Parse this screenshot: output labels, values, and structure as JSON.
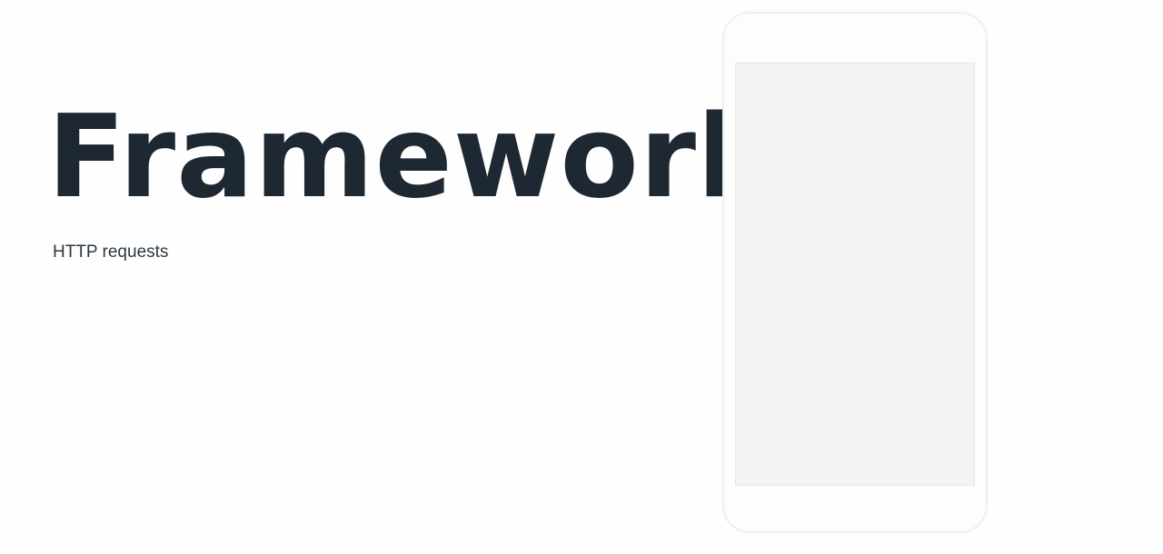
{
  "slide": {
    "title": "Framework",
    "subtitle": "HTTP requests"
  },
  "colors": {
    "background": "#fefefe",
    "title": "#1e2832",
    "subtitle": "#2e3842",
    "phone_outline": "#eef0f0",
    "phone_screen": "#f1f4f3"
  }
}
